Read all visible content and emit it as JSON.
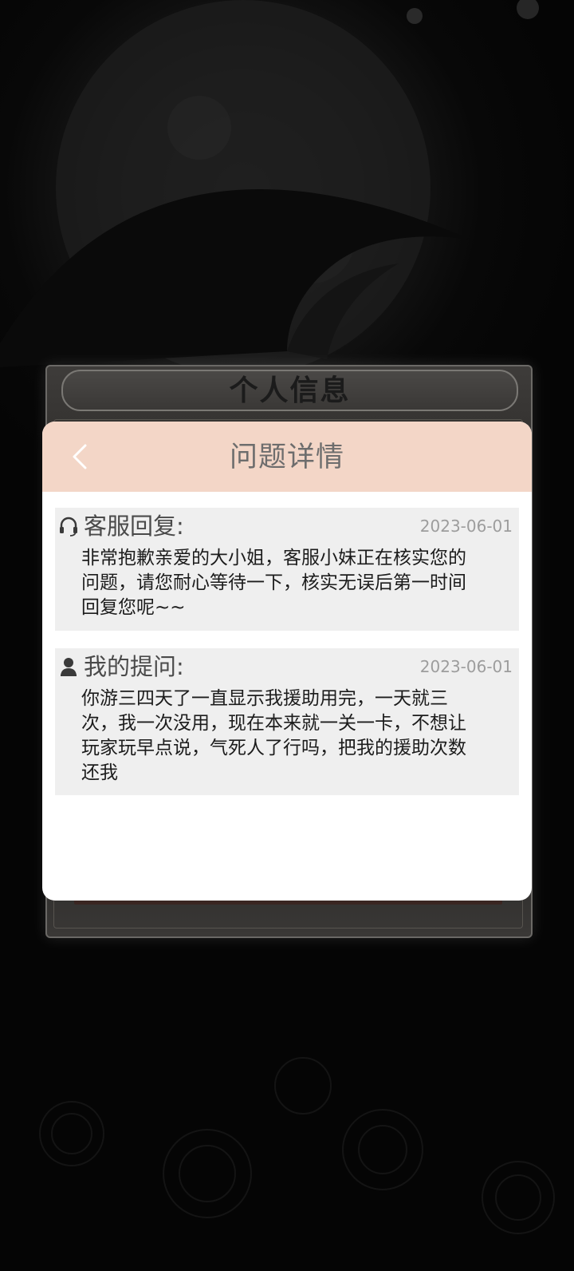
{
  "background_panel": {
    "title": "个人信息"
  },
  "modal": {
    "title": "问题详情",
    "back_icon": "chevron-left-icon"
  },
  "reply": {
    "icon": "headset-icon",
    "label": "客服回复:",
    "date": "2023-06-01",
    "body": "非常抱歉亲爱的大小姐，客服小妹正在核实您的问题，请您耐心等待一下，核实无误后第一时间回复您呢~~"
  },
  "question": {
    "icon": "user-icon",
    "label": "我的提问:",
    "date": "2023-06-01",
    "body": "你游三四天了一直显示我援助用完，一天就三次，我一次没用，现在本来就一关一卡，不想让玩家玩早点说，气死人了行吗，把我的援助次数还我"
  },
  "colors": {
    "header_bg": "#f3d6c7",
    "card_bg": "#efefef",
    "date_text": "#9d9d9d"
  }
}
